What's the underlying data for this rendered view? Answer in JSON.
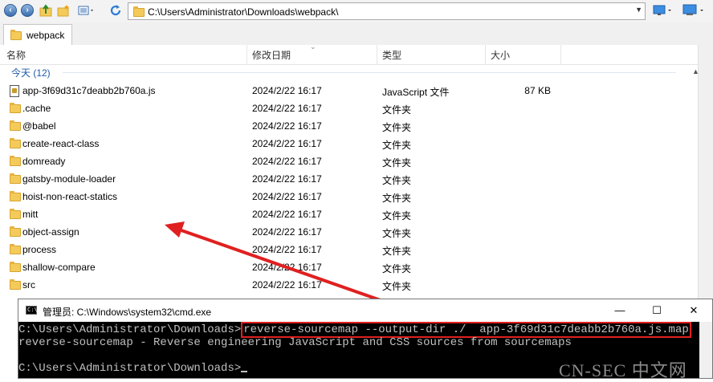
{
  "explorer": {
    "address_path": "C:\\Users\\Administrator\\Downloads\\webpack\\",
    "tab_label": "webpack",
    "columns": {
      "name": "名称",
      "date": "修改日期",
      "type": "类型",
      "size": "大小"
    },
    "group_label": "今天 (12)",
    "files": [
      {
        "name": "app-3f69d31c7deabb2b760a.js",
        "date": "2024/2/22 16:17",
        "type": "JavaScript 文件",
        "size": "87 KB",
        "icon": "js-file-icon"
      },
      {
        "name": ".cache",
        "date": "2024/2/22 16:17",
        "type": "文件夹",
        "size": "",
        "icon": "folder-icon"
      },
      {
        "name": "@babel",
        "date": "2024/2/22 16:17",
        "type": "文件夹",
        "size": "",
        "icon": "folder-icon"
      },
      {
        "name": "create-react-class",
        "date": "2024/2/22 16:17",
        "type": "文件夹",
        "size": "",
        "icon": "folder-icon"
      },
      {
        "name": "domready",
        "date": "2024/2/22 16:17",
        "type": "文件夹",
        "size": "",
        "icon": "folder-icon"
      },
      {
        "name": "gatsby-module-loader",
        "date": "2024/2/22 16:17",
        "type": "文件夹",
        "size": "",
        "icon": "folder-icon"
      },
      {
        "name": "hoist-non-react-statics",
        "date": "2024/2/22 16:17",
        "type": "文件夹",
        "size": "",
        "icon": "folder-icon"
      },
      {
        "name": "mitt",
        "date": "2024/2/22 16:17",
        "type": "文件夹",
        "size": "",
        "icon": "folder-icon"
      },
      {
        "name": "object-assign",
        "date": "2024/2/22 16:17",
        "type": "文件夹",
        "size": "",
        "icon": "folder-icon"
      },
      {
        "name": "process",
        "date": "2024/2/22 16:17",
        "type": "文件夹",
        "size": "",
        "icon": "folder-icon"
      },
      {
        "name": "shallow-compare",
        "date": "2024/2/22 16:17",
        "type": "文件夹",
        "size": "",
        "icon": "folder-icon"
      },
      {
        "name": "src",
        "date": "2024/2/22 16:17",
        "type": "文件夹",
        "size": "",
        "icon": "folder-icon"
      }
    ]
  },
  "cmd": {
    "title": "管理员: C:\\Windows\\system32\\cmd.exe",
    "prompt1": "C:\\Users\\Administrator\\Downloads>",
    "command": "reverse-sourcemap --output-dir ./  app-3f69d31c7deabb2b760a.js.map",
    "output": "reverse-sourcemap - Reverse engineering JavaScript and CSS sources from sourcemaps",
    "prompt2": "C:\\Users\\Administrator\\Downloads>"
  },
  "watermark": "CN-SEC 中文网",
  "colors": {
    "annotation_red": "#e02020",
    "group_blue": "#1e5aa8",
    "console_bg": "#000000",
    "console_text": "#c0c0c0"
  }
}
